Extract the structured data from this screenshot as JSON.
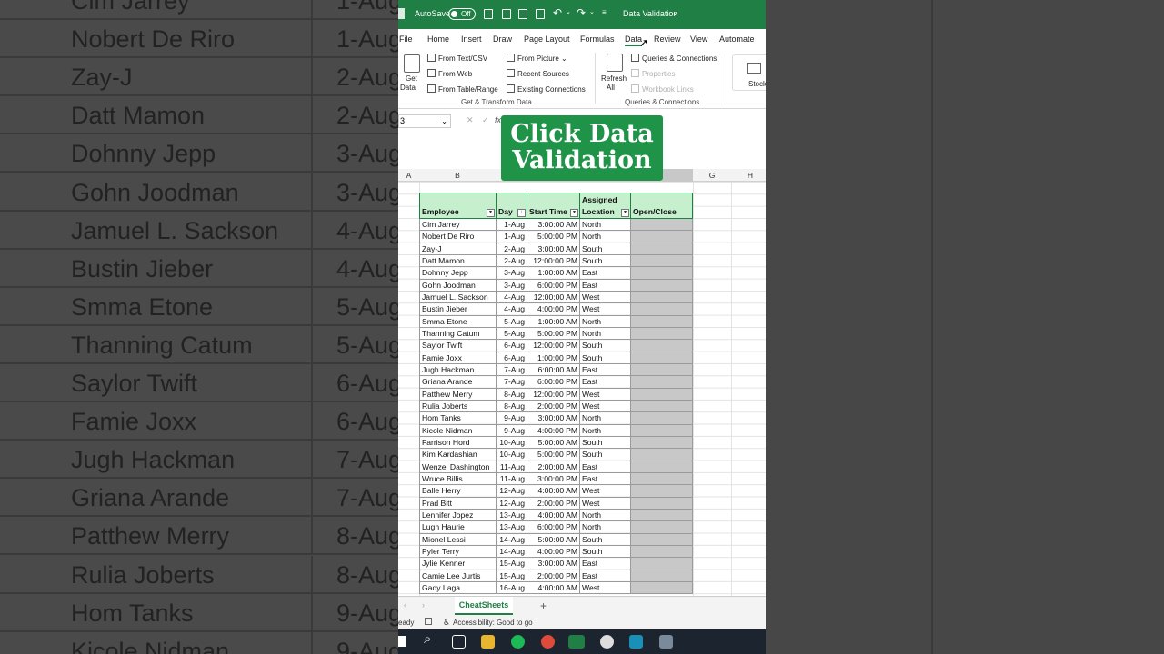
{
  "background": {
    "rows": [
      {
        "name": "Cim Jarrey",
        "day": "1-Aug"
      },
      {
        "name": "Nobert De Riro",
        "day": "1-Aug"
      },
      {
        "name": "Zay-J",
        "day": "2-Aug"
      },
      {
        "name": "Datt Mamon",
        "day": "2-Aug"
      },
      {
        "name": "Dohnny Jepp",
        "day": "3-Aug"
      },
      {
        "name": "Gohn Joodman",
        "day": "3-Aug"
      },
      {
        "name": "Jamuel L. Sackson",
        "day": "4-Aug"
      },
      {
        "name": "Bustin Jieber",
        "day": "4-Aug"
      },
      {
        "name": "Smma Etone",
        "day": "5-Aug"
      },
      {
        "name": "Thanning Catum",
        "day": "5-Aug"
      },
      {
        "name": "Saylor Twift",
        "day": "6-Aug"
      },
      {
        "name": "Famie Joxx",
        "day": "6-Aug"
      },
      {
        "name": "Jugh Hackman",
        "day": "7-Aug"
      },
      {
        "name": "Griana Arande",
        "day": "7-Aug"
      },
      {
        "name": "Patthew Merry",
        "day": "8-Aug"
      },
      {
        "name": "Rulia Joberts",
        "day": "8-Aug"
      },
      {
        "name": "Hom Tanks",
        "day": "9-Aug"
      },
      {
        "name": "Kicole Nidman",
        "day": "9-Aug"
      }
    ]
  },
  "titlebar": {
    "autosave_label": "AutoSave",
    "toggle_label": "Off",
    "doc_title": "Data Validation",
    "accent": "#1f7f45"
  },
  "menu": {
    "file": "File",
    "home": "Home",
    "insert": "Insert",
    "draw": "Draw",
    "page_layout": "Page Layout",
    "formulas": "Formulas",
    "data": "Data",
    "review": "Review",
    "view": "View",
    "automate": "Automate"
  },
  "ribbon": {
    "get_data_1": "Get",
    "get_data_2": "Data",
    "from_text_csv": "From Text/CSV",
    "from_web": "From Web",
    "from_table_range": "From Table/Range",
    "from_picture": "From Picture",
    "recent_sources": "Recent Sources",
    "existing_connections": "Existing Connections",
    "group_get_transform": "Get & Transform Data",
    "refresh_1": "Refresh",
    "refresh_2": "All",
    "queries_connections": "Queries & Connections",
    "properties": "Properties",
    "workbook_links": "Workbook Links",
    "group_queries": "Queries & Connections",
    "stocks": "Stock"
  },
  "formula": {
    "namebox": "3",
    "fx": "fx"
  },
  "overlay": {
    "line1": "Click Data",
    "line2": "Validation"
  },
  "columns": {
    "a": "A",
    "b": "B",
    "g": "G",
    "h": "H"
  },
  "table": {
    "headers": {
      "employee": "Employee",
      "day": "Day",
      "start_time": "Start Time",
      "location_1": "Assigned",
      "location_2": "Location",
      "open_close": "Open/Close"
    },
    "rows": [
      {
        "employee": "Cim Jarrey",
        "day": "1-Aug",
        "start": "3:00:00 AM",
        "loc": "North"
      },
      {
        "employee": "Nobert De Riro",
        "day": "1-Aug",
        "start": "5:00:00 PM",
        "loc": "North"
      },
      {
        "employee": "Zay-J",
        "day": "2-Aug",
        "start": "3:00:00 AM",
        "loc": "South"
      },
      {
        "employee": "Datt Mamon",
        "day": "2-Aug",
        "start": "12:00:00 PM",
        "loc": "South"
      },
      {
        "employee": "Dohnny Jepp",
        "day": "3-Aug",
        "start": "1:00:00 AM",
        "loc": "East"
      },
      {
        "employee": "Gohn Joodman",
        "day": "3-Aug",
        "start": "6:00:00 PM",
        "loc": "East"
      },
      {
        "employee": "Jamuel L. Sackson",
        "day": "4-Aug",
        "start": "12:00:00 AM",
        "loc": "West"
      },
      {
        "employee": "Bustin Jieber",
        "day": "4-Aug",
        "start": "4:00:00 PM",
        "loc": "West"
      },
      {
        "employee": "Smma Etone",
        "day": "5-Aug",
        "start": "1:00:00 AM",
        "loc": "North"
      },
      {
        "employee": "Thanning Catum",
        "day": "5-Aug",
        "start": "5:00:00 PM",
        "loc": "North"
      },
      {
        "employee": "Saylor Twift",
        "day": "6-Aug",
        "start": "12:00:00 PM",
        "loc": "South"
      },
      {
        "employee": "Famie Joxx",
        "day": "6-Aug",
        "start": "1:00:00 PM",
        "loc": "South"
      },
      {
        "employee": "Jugh Hackman",
        "day": "7-Aug",
        "start": "6:00:00 AM",
        "loc": "East"
      },
      {
        "employee": "Griana Arande",
        "day": "7-Aug",
        "start": "6:00:00 PM",
        "loc": "East"
      },
      {
        "employee": "Patthew Merry",
        "day": "8-Aug",
        "start": "12:00:00 PM",
        "loc": "West"
      },
      {
        "employee": "Rulia Joberts",
        "day": "8-Aug",
        "start": "2:00:00 PM",
        "loc": "West"
      },
      {
        "employee": "Hom Tanks",
        "day": "9-Aug",
        "start": "3:00:00 AM",
        "loc": "North"
      },
      {
        "employee": "Kicole Nidman",
        "day": "9-Aug",
        "start": "4:00:00 PM",
        "loc": "North"
      },
      {
        "employee": "Farrison Hord",
        "day": "10-Aug",
        "start": "5:00:00 AM",
        "loc": "South"
      },
      {
        "employee": "Kim Kardashian",
        "day": "10-Aug",
        "start": "5:00:00 PM",
        "loc": "South"
      },
      {
        "employee": "Wenzel Dashington",
        "day": "11-Aug",
        "start": "2:00:00 AM",
        "loc": "East"
      },
      {
        "employee": "Wruce Billis",
        "day": "11-Aug",
        "start": "3:00:00 PM",
        "loc": "East"
      },
      {
        "employee": "Balle Herry",
        "day": "12-Aug",
        "start": "4:00:00 AM",
        "loc": "West"
      },
      {
        "employee": "Prad Bitt",
        "day": "12-Aug",
        "start": "2:00:00 PM",
        "loc": "West"
      },
      {
        "employee": "Lennifer Jopez",
        "day": "13-Aug",
        "start": "4:00:00 AM",
        "loc": "North"
      },
      {
        "employee": "Lugh Haurie",
        "day": "13-Aug",
        "start": "6:00:00 PM",
        "loc": "North"
      },
      {
        "employee": "Mionel Lessi",
        "day": "14-Aug",
        "start": "5:00:00 AM",
        "loc": "South"
      },
      {
        "employee": "Pyler Terry",
        "day": "14-Aug",
        "start": "4:00:00 PM",
        "loc": "South"
      },
      {
        "employee": "Jylie Kenner",
        "day": "15-Aug",
        "start": "3:00:00 AM",
        "loc": "East"
      },
      {
        "employee": "Camie Lee Jurtis",
        "day": "15-Aug",
        "start": "2:00:00 PM",
        "loc": "East"
      },
      {
        "employee": "Gady Laga",
        "day": "16-Aug",
        "start": "4:00:00 AM",
        "loc": "West"
      }
    ]
  },
  "sheets": {
    "active": "CheatSheets",
    "add": "+"
  },
  "status": {
    "ready": "eady",
    "accessibility": "Accessibility: Good to go"
  }
}
